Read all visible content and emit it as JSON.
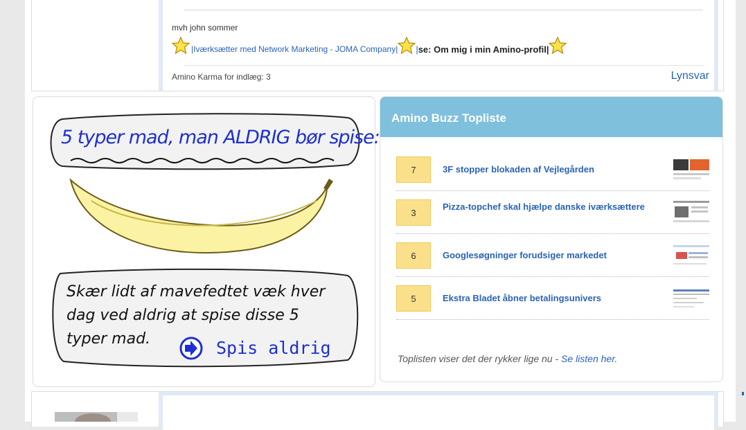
{
  "post": {
    "sig_name": "mvh john sommer",
    "sig_link1": "|Iværksætter med Network Marketing - JOMA Company|",
    "sig_link2_pipe": "|",
    "sig_link2": "se: Om mig i min Amino-profil|",
    "karma": "Amino Karma for indlæg: 3",
    "reply": "Lynsvar",
    "star_icon": "star-icon"
  },
  "ad": {
    "headline": "5 typer mad, man ALDRIG bør spise:",
    "body_line1": "Skær lidt af mavefedtet væk hver",
    "body_line2": "dag ved aldrig at spise disse 5",
    "body_line3": "typer mad.",
    "cta": "Spis aldrig"
  },
  "topliste": {
    "title": "Amino Buzz Topliste",
    "items": [
      {
        "rank": "7",
        "title": "3F stopper blokaden af Vejlegården"
      },
      {
        "rank": "3",
        "title": "Pizza-topchef skal hjælpe danske iværksættere"
      },
      {
        "rank": "6",
        "title": "Googlesøgninger forudsiger markedet"
      },
      {
        "rank": "5",
        "title": "Ekstra Bladet åbner betalingsunivers"
      }
    ],
    "footer_text": "Toplisten viser det der rykker lige nu - ",
    "footer_link": "Se listen her",
    "footer_end": "."
  },
  "colors": {
    "link": "#2a63b7",
    "header": "#7fc0dc",
    "rank_bg": "#fbe08b",
    "ad_text": "#1d2fd1"
  }
}
